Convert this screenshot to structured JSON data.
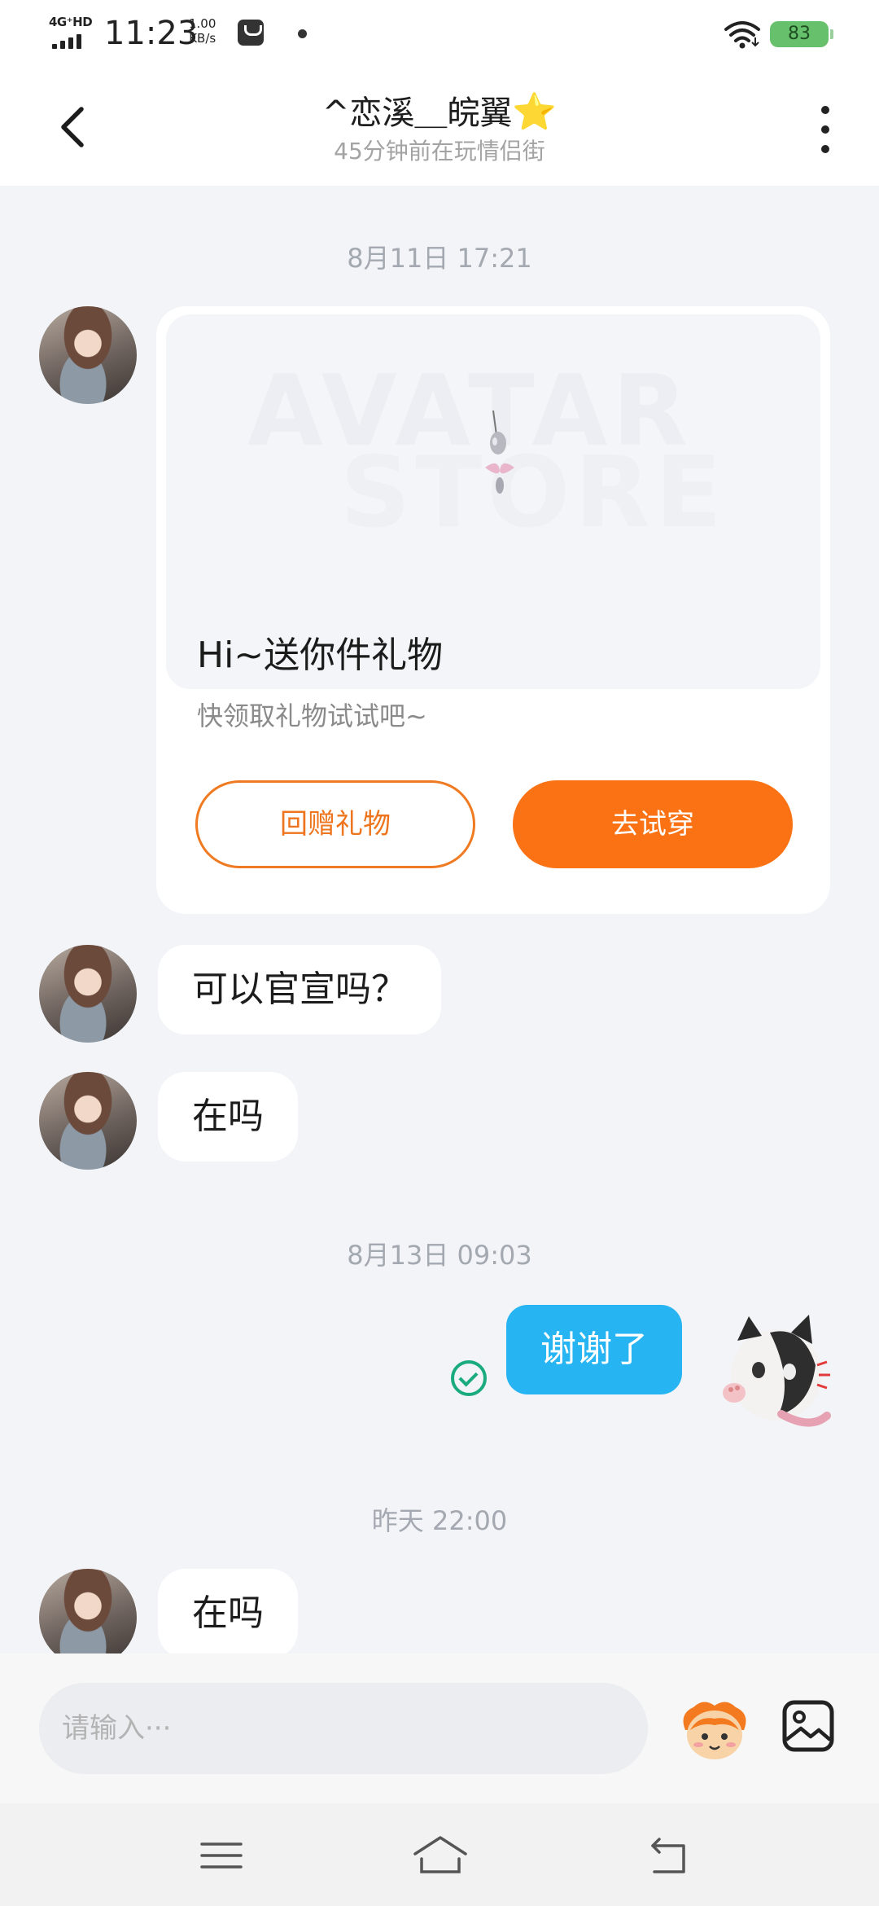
{
  "status_bar": {
    "network": "4G⁺HD",
    "time": "11:23",
    "speed_value": "1.00",
    "speed_unit": "KB/s",
    "battery": "83"
  },
  "header": {
    "title": "^恋溪＿皖翼",
    "title_star": "⭐",
    "subtitle": "45分钟前在玩情侣街"
  },
  "chat": {
    "timestamps": [
      "8月11日 17:21",
      "8月13日 09:03",
      "昨天 22:00"
    ],
    "gift_card": {
      "watermark_line1": "AVATAR",
      "watermark_line2": "STORE",
      "title": "Hi~送你件礼物",
      "description": "快领取礼物试试吧~",
      "return_button": "回赠礼物",
      "try_button": "去试穿"
    },
    "messages": [
      {
        "from": "them",
        "text": "可以官宣吗？"
      },
      {
        "from": "them",
        "text": "在吗"
      },
      {
        "from": "me",
        "text": "谢谢了"
      },
      {
        "from": "them",
        "text": "在吗"
      }
    ]
  },
  "input": {
    "placeholder": "请输入···"
  },
  "colors": {
    "accent_orange": "#fb7214",
    "my_bubble": "#26b4f3",
    "sent_check": "#1aab7d"
  },
  "icons": [
    "back-arrow-icon",
    "more-vertical-icon",
    "emoji-face-icon",
    "image-icon",
    "menu-icon",
    "home-icon",
    "back-nav-icon",
    "wifi-icon",
    "signal-icon",
    "sent-check-icon"
  ]
}
